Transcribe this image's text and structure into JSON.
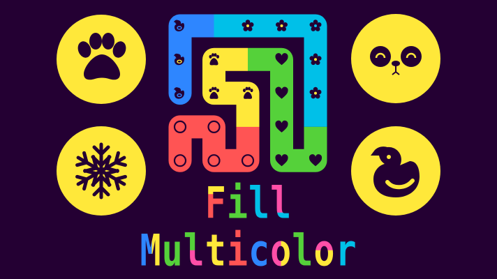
{
  "colors": {
    "background": "#240033",
    "badge": "#ffe83a",
    "ink": "#240033",
    "blue": "#2e86ff",
    "cyan": "#00c0e8",
    "green": "#55d13a",
    "yellow": "#ffe83a",
    "red": "#ff5454",
    "pink": "#ff4fa8"
  },
  "badges": [
    "paw-icon",
    "panda-face-icon",
    "snowflake-icon",
    "duck-icon"
  ],
  "board": {
    "cols": 5,
    "rows": 5,
    "segments": [
      {
        "color": "blue",
        "cells": [
          [
            0,
            2
          ],
          [
            0,
            0
          ],
          [
            1,
            0
          ]
        ]
      },
      {
        "color": "cyan",
        "cells": [
          [
            1,
            0
          ],
          [
            4,
            0
          ],
          [
            4,
            3
          ]
        ]
      },
      {
        "color": "green",
        "cells": [
          [
            4,
            3
          ],
          [
            4,
            4
          ],
          [
            3,
            4
          ],
          [
            3,
            1
          ],
          [
            2,
            1
          ]
        ]
      },
      {
        "color": "yellow",
        "cells": [
          [
            2,
            1
          ],
          [
            1,
            1
          ],
          [
            1,
            2
          ],
          [
            2,
            2
          ],
          [
            2,
            3
          ]
        ]
      },
      {
        "color": "red",
        "cells": [
          [
            2,
            3
          ],
          [
            2,
            4
          ],
          [
            1,
            4
          ],
          [
            1,
            3
          ],
          [
            0,
            3
          ],
          [
            0,
            4
          ]
        ]
      }
    ],
    "tile_icons": [
      {
        "icon": "duck",
        "cell": [
          0,
          0
        ]
      },
      {
        "icon": "duck",
        "cell": [
          0,
          1
        ]
      },
      {
        "icon": "duck",
        "cell": [
          0,
          2
        ]
      },
      {
        "icon": "flower",
        "cell": [
          2,
          0
        ]
      },
      {
        "icon": "flower",
        "cell": [
          3,
          0
        ]
      },
      {
        "icon": "flower",
        "cell": [
          4,
          0
        ]
      },
      {
        "icon": "flower",
        "cell": [
          4,
          1
        ]
      },
      {
        "icon": "flower",
        "cell": [
          4,
          2
        ]
      },
      {
        "icon": "heart",
        "cell": [
          3,
          1
        ]
      },
      {
        "icon": "heart",
        "cell": [
          3,
          2
        ]
      },
      {
        "icon": "heart",
        "cell": [
          3,
          3
        ]
      },
      {
        "icon": "heart",
        "cell": [
          3,
          4
        ]
      },
      {
        "icon": "heart",
        "cell": [
          4,
          4
        ]
      },
      {
        "icon": "paw",
        "cell": [
          1,
          1
        ]
      },
      {
        "icon": "paw",
        "cell": [
          1,
          2
        ]
      },
      {
        "icon": "paw",
        "cell": [
          2,
          2
        ]
      },
      {
        "icon": "ring",
        "cell": [
          0,
          3
        ]
      },
      {
        "icon": "ring",
        "cell": [
          1,
          3
        ]
      },
      {
        "icon": "ring",
        "cell": [
          0,
          4
        ]
      },
      {
        "icon": "ring",
        "cell": [
          1,
          4
        ]
      },
      {
        "icon": "ring",
        "cell": [
          2,
          4
        ]
      }
    ]
  },
  "title": {
    "line1": [
      {
        "ch": "F",
        "split": "top",
        "colors": [
          "yellow",
          "red"
        ]
      },
      {
        "ch": "i",
        "split": "none",
        "colors": [
          "green"
        ]
      },
      {
        "ch": "l",
        "split": "none",
        "colors": [
          "cyan"
        ]
      },
      {
        "ch": "l",
        "split": "bottom",
        "colors": [
          "pink",
          "cyan"
        ]
      }
    ],
    "line2": [
      {
        "ch": "M",
        "split": "left",
        "colors": [
          "blue",
          "yellow"
        ]
      },
      {
        "ch": "u",
        "split": "top",
        "colors": [
          "yellow",
          "green"
        ]
      },
      {
        "ch": "l",
        "split": "half",
        "colors": [
          "green",
          "pink"
        ]
      },
      {
        "ch": "t",
        "split": "none",
        "colors": [
          "yellow"
        ]
      },
      {
        "ch": "i",
        "split": "none",
        "colors": [
          "red"
        ]
      },
      {
        "ch": "c",
        "split": "none",
        "colors": [
          "blue"
        ]
      },
      {
        "ch": "o",
        "split": "leftright",
        "colors": [
          "pink",
          "yellow"
        ]
      },
      {
        "ch": "l",
        "split": "none",
        "colors": [
          "green"
        ]
      },
      {
        "ch": "o",
        "split": "half",
        "colors": [
          "pink",
          "yellow"
        ]
      },
      {
        "ch": "r",
        "split": "none",
        "colors": [
          "cyan"
        ]
      }
    ]
  }
}
